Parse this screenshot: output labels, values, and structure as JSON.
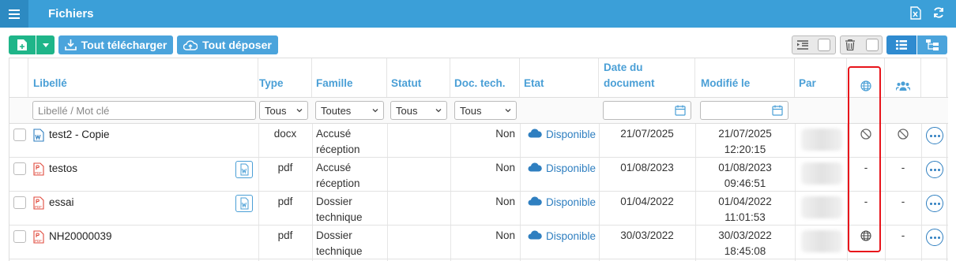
{
  "window": {
    "title": "Fichiers",
    "menu_icon": "hamburger-icon",
    "right_icons": [
      "excel-export-icon",
      "refresh-icon"
    ]
  },
  "toolbar": {
    "new_file_icon": "new-file-icon",
    "dropdown_icon": "chevron-down-icon",
    "download_all_label": "Tout télécharger",
    "upload_all_label": "Tout déposer",
    "indent_icon": "indent-icon",
    "trash_icon": "trash-icon",
    "list_view_icon": "list-view-icon",
    "tree_view_icon": "tree-view-icon"
  },
  "columns": {
    "libelle": "Libellé",
    "type": "Type",
    "famille": "Famille",
    "statut": "Statut",
    "doc_tech": "Doc. tech.",
    "etat": "Etat",
    "date_doc_line1": "Date du",
    "date_doc_line2": "document",
    "modifie": "Modifié le",
    "par": "Par",
    "web_icon": "globe-icon",
    "users_icon": "users-icon"
  },
  "filters": {
    "libelle_placeholder": "Libellé / Mot clé",
    "type": "Tous",
    "famille": "Toutes",
    "statut": "Tous",
    "doc_tech": "Tous"
  },
  "rows": [
    {
      "name": "test2 - Copie",
      "file_icon": "word-file-icon",
      "has_word_badge": false,
      "type": "docx",
      "famille_1": "Accusé",
      "famille_2": "réception",
      "doc_tech": "Non",
      "etat": "Disponible",
      "date_doc": "21/07/2025",
      "modifie_1": "21/07/2025",
      "modifie_2": "12:20:15",
      "web": "ban-icon",
      "users": "ban-icon"
    },
    {
      "name": "testos",
      "file_icon": "pdf-file-icon",
      "has_word_badge": true,
      "type": "pdf",
      "famille_1": "Accusé",
      "famille_2": "réception",
      "doc_tech": "Non",
      "etat": "Disponible",
      "date_doc": "01/08/2023",
      "modifie_1": "01/08/2023",
      "modifie_2": "09:46:51",
      "web": "-",
      "users": "-"
    },
    {
      "name": "essai",
      "file_icon": "pdf-file-icon",
      "has_word_badge": true,
      "type": "pdf",
      "famille_1": "Dossier",
      "famille_2": "technique",
      "doc_tech": "Non",
      "etat": "Disponible",
      "date_doc": "01/04/2022",
      "modifie_1": "01/04/2022",
      "modifie_2": "11:01:53",
      "web": "-",
      "users": "-"
    },
    {
      "name": "NH20000039",
      "file_icon": "pdf-file-icon",
      "has_word_badge": false,
      "type": "pdf",
      "famille_1": "Dossier",
      "famille_2": "technique",
      "doc_tech": "Non",
      "etat": "Disponible",
      "date_doc": "30/03/2022",
      "modifie_1": "30/03/2022",
      "modifie_2": "18:45:08",
      "web": "globe-icon",
      "users": "-"
    }
  ],
  "colors": {
    "header_bar": "#3b9fd8",
    "accent": "#4a9fd6",
    "link": "#2f7fc0",
    "green": "#1fb589",
    "highlight": "#e8141b"
  }
}
